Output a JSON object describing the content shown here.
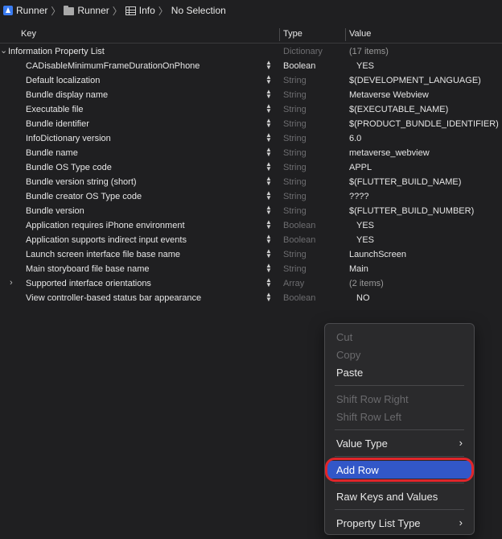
{
  "breadcrumb": {
    "items": [
      "Runner",
      "Runner",
      "Info",
      "No Selection"
    ]
  },
  "table": {
    "headers": {
      "key": "Key",
      "type": "Type",
      "value": "Value"
    },
    "root": {
      "key": "Information Property List",
      "type": "Dictionary",
      "value": "(17 items)"
    },
    "rows": [
      {
        "key": "CADisableMinimumFrameDurationOnPhone",
        "type": "Boolean",
        "value": "YES"
      },
      {
        "key": "Default localization",
        "type": "String",
        "value": "$(DEVELOPMENT_LANGUAGE)"
      },
      {
        "key": "Bundle display name",
        "type": "String",
        "value": "Metaverse Webview"
      },
      {
        "key": "Executable file",
        "type": "String",
        "value": "$(EXECUTABLE_NAME)"
      },
      {
        "key": "Bundle identifier",
        "type": "String",
        "value": "$(PRODUCT_BUNDLE_IDENTIFIER)"
      },
      {
        "key": "InfoDictionary version",
        "type": "String",
        "value": "6.0"
      },
      {
        "key": "Bundle name",
        "type": "String",
        "value": "metaverse_webview"
      },
      {
        "key": "Bundle OS Type code",
        "type": "String",
        "value": "APPL"
      },
      {
        "key": "Bundle version string (short)",
        "type": "String",
        "value": "$(FLUTTER_BUILD_NAME)"
      },
      {
        "key": "Bundle creator OS Type code",
        "type": "String",
        "value": "????"
      },
      {
        "key": "Bundle version",
        "type": "String",
        "value": "$(FLUTTER_BUILD_NUMBER)"
      },
      {
        "key": "Application requires iPhone environment",
        "type": "Boolean",
        "value": "YES"
      },
      {
        "key": "Application supports indirect input events",
        "type": "Boolean",
        "value": "YES"
      },
      {
        "key": "Launch screen interface file base name",
        "type": "String",
        "value": "LaunchScreen"
      },
      {
        "key": "Main storyboard file base name",
        "type": "String",
        "value": "Main"
      },
      {
        "key": "Supported interface orientations",
        "type": "Array",
        "value": "(2 items)"
      },
      {
        "key": "View controller-based status bar appearance",
        "type": "Boolean",
        "value": "NO"
      }
    ]
  },
  "menu": {
    "cut": "Cut",
    "copy": "Copy",
    "paste": "Paste",
    "shift_right": "Shift Row Right",
    "shift_left": "Shift Row Left",
    "value_type": "Value Type",
    "add_row": "Add Row",
    "raw_keys": "Raw Keys and Values",
    "plist_type": "Property List Type"
  },
  "colors": {
    "menu_highlight": "#3257c8",
    "annotation_ring": "#e0262b"
  }
}
